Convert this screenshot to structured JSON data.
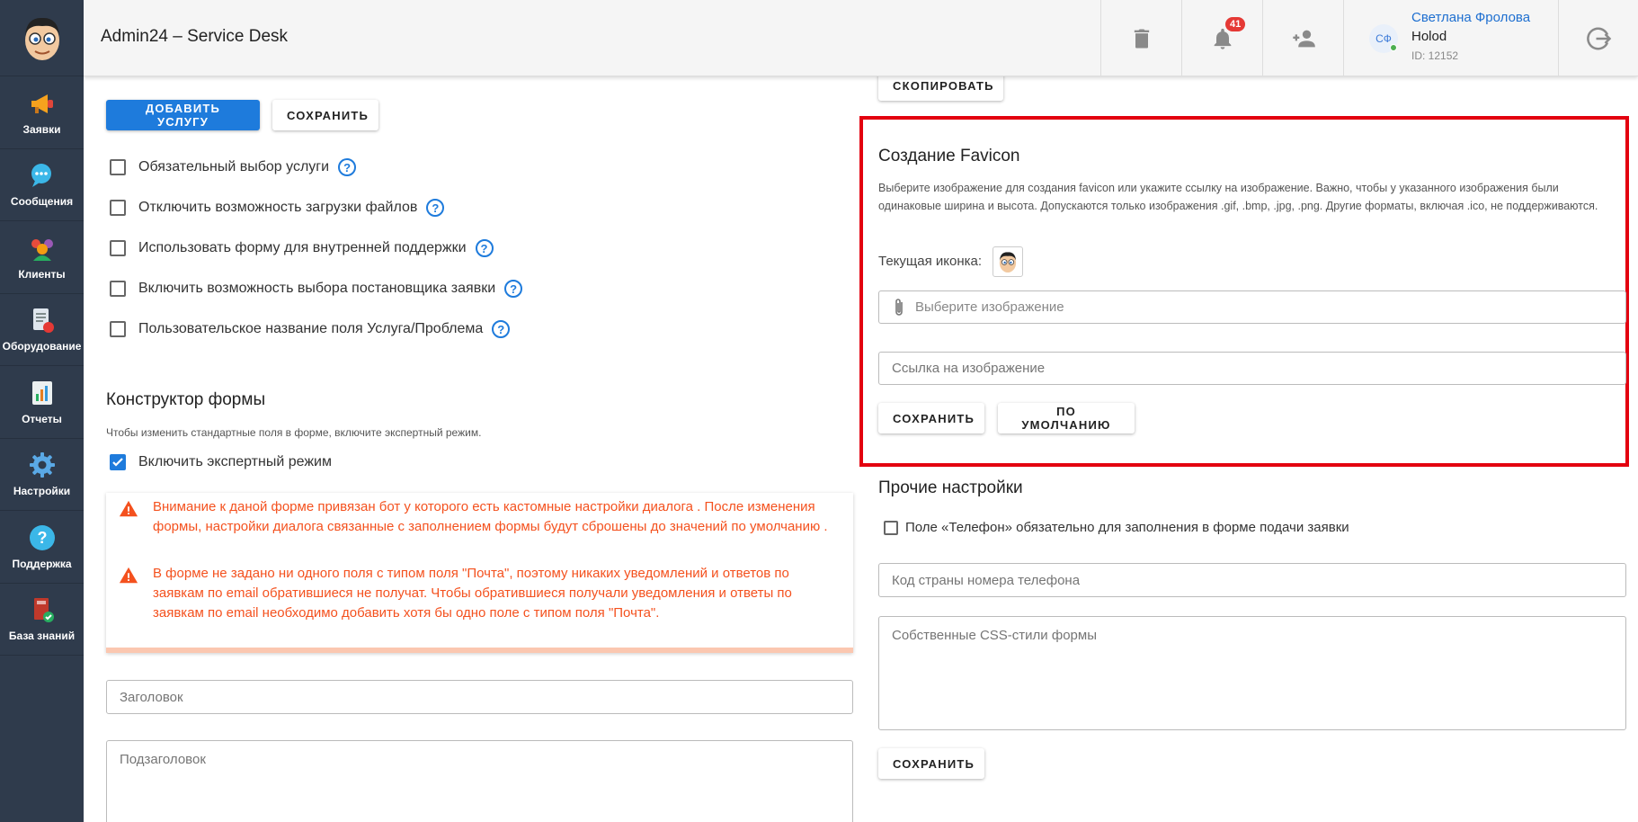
{
  "app": {
    "title": "Admin24 – Service Desk"
  },
  "sidebar": {
    "items": [
      {
        "label": "Заявки",
        "icon": "megaphone-icon"
      },
      {
        "label": "Сообщения",
        "icon": "chat-icon"
      },
      {
        "label": "Клиенты",
        "icon": "clients-icon"
      },
      {
        "label": "Оборудование",
        "icon": "equipment-icon"
      },
      {
        "label": "Отчеты",
        "icon": "reports-icon"
      },
      {
        "label": "Настройки",
        "icon": "gear-icon"
      },
      {
        "label": "Поддержка",
        "icon": "help-icon"
      },
      {
        "label": "База знаний",
        "icon": "knowledge-base-icon"
      }
    ]
  },
  "header": {
    "notifications_count": "41",
    "user": {
      "initials": "СФ",
      "name": "Светлана Фролова",
      "org": "Holod",
      "id": "ID: 12152"
    }
  },
  "left": {
    "add_service_label": "Добавить услугу",
    "save_label": "Сохранить",
    "checkboxes": [
      {
        "label": "Обязательный выбор услуги",
        "checked": false
      },
      {
        "label": "Отключить возможность загрузки файлов",
        "checked": false
      },
      {
        "label": "Использовать форму для внутренней поддержки",
        "checked": false
      },
      {
        "label": "Включить возможность выбора постановщика заявки",
        "checked": false
      },
      {
        "label": "Пользовательское название поля Услуга/Проблема",
        "checked": false
      }
    ],
    "form_builder": {
      "title": "Конструктор формы",
      "hint": "Чтобы изменить стандартные поля в форме, включите экспертный режим.",
      "expert_mode_label": "Включить экспертный режим",
      "expert_mode_checked": true
    },
    "warnings": [
      "Внимание к даной форме привязан бот у которого есть кастомные настройки диалога . После изменения формы, настройки диалога связанные с заполнением формы будут сброшены до значений по умолчанию .",
      "В форме не задано ни одного поля с типом поля \"Почта\", поэтому никаких уведомлений и ответов по заявкам по email обратившиеся не получат. Чтобы обратившиеся получали уведомления и ответы по заявкам по email необходимо добавить хотя бы одно поле с типом поля \"Почта\"."
    ],
    "heading_placeholder": "Заголовок",
    "subheading_placeholder": "Подзаголовок"
  },
  "right": {
    "copy_label": "Скопировать",
    "favicon": {
      "title": "Создание Favicon",
      "description": "Выберите изображение для создания favicon или укажите ссылку на изображение. Важно, чтобы у указанного изображения были одинаковые ширина и высота. Допускаются только изображения .gif, .bmp, .jpg, .png. Другие форматы, включая .ico, не поддерживаются.",
      "current_icon_label": "Текущая иконка:",
      "file_placeholder": "Выберите изображение",
      "url_placeholder": "Ссылка на изображение",
      "save_label": "Сохранить",
      "default_label": "По умолчанию"
    },
    "other": {
      "title": "Прочие настройки",
      "phone_required_label": "Поле «Телефон» обязательно для заполнения в форме подачи заявки",
      "phone_required_checked": false,
      "country_code_placeholder": "Код страны номера телефона",
      "css_placeholder": "Собственные CSS-стили формы",
      "save_label": "Сохранить"
    }
  },
  "colors": {
    "accent": "#1e7bdc",
    "sidebar": "#2f3b4c",
    "warning": "#f4511e",
    "highlight": "#e3000f"
  }
}
